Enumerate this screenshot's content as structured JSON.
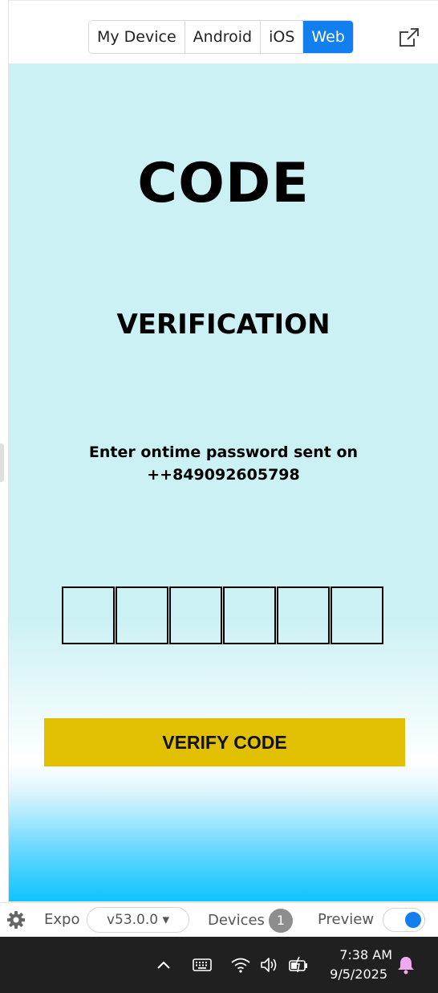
{
  "topbar": {
    "tabs": [
      {
        "label": "My Device",
        "active": false
      },
      {
        "label": "Android",
        "active": false
      },
      {
        "label": "iOS",
        "active": false
      },
      {
        "label": "Web",
        "active": true
      }
    ],
    "external_link_icon": "external-link-icon"
  },
  "app": {
    "title": "CODE",
    "subtitle": "VERIFICATION",
    "instruction_line1": "Enter ontime password sent on",
    "instruction_line2": "++849092605798",
    "otp_box_count": 6,
    "verify_label": "VERIFY CODE",
    "colors": {
      "background": "#cbf1f4",
      "button": "#e0c000",
      "gradient_bottom": "#0ec4ff"
    }
  },
  "expo_bar": {
    "settings_icon": "gear-icon",
    "expo_label": "Expo",
    "version": "v53.0.0 ▾",
    "devices_label": "Devices",
    "devices_count": "1",
    "preview_label": "Preview",
    "preview_enabled": true,
    "accent": "#1180ee"
  },
  "taskbar": {
    "icons": [
      "chevron-up-icon",
      "keyboard-icon",
      "wifi-icon",
      "volume-icon",
      "battery-icon",
      "notification-bell-icon"
    ],
    "time": "7:38 AM",
    "date": "9/5/2025"
  }
}
